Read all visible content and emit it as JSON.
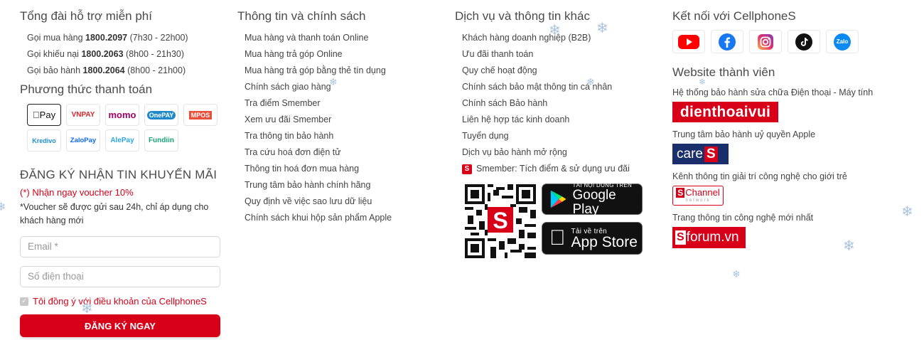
{
  "support": {
    "title": "Tổng đài hỗ trợ miễn phí",
    "lines": [
      {
        "prefix": "Gọi mua hàng",
        "number": "1800.2097",
        "hours": "(7h30 - 22h00)"
      },
      {
        "prefix": "Gọi khiếu nại",
        "number": "1800.2063",
        "hours": "(8h00 - 21h30)"
      },
      {
        "prefix": "Gọi bảo hành",
        "number": "1800.2064",
        "hours": "(8h00 - 21h00)"
      }
    ]
  },
  "payment": {
    "title": "Phương thức thanh toán",
    "methods": [
      "Pay",
      "VNPAY",
      "momo",
      "OnePAY",
      "MPOS",
      "Kredivo",
      "ZaloPay",
      "AlePay",
      "Fundiin"
    ]
  },
  "newsletter": {
    "title": "ĐĂNG KÝ NHẬN TIN KHUYẾN MÃI",
    "voucher": "(*) Nhận ngay voucher 10%",
    "note": "*Voucher sẽ được gửi sau 24h, chỉ áp dụng cho khách hàng mới",
    "email_placeholder": "Email *",
    "phone_placeholder": "Số điện thoại",
    "agree_text": "Tôi đồng ý với điều khoản của CellphoneS",
    "submit_label": "ĐĂNG KÝ NGAY"
  },
  "policy": {
    "title": "Thông tin và chính sách",
    "links": [
      "Mua hàng và thanh toán Online",
      "Mua hàng trả góp Online",
      "Mua hàng trả góp bằng thẻ tín dụng",
      "Chính sách giao hàng",
      "Tra điểm Smember",
      "Xem ưu đãi Smember",
      "Tra thông tin bảo hành",
      "Tra cứu hoá đơn điện tử",
      "Thông tin hoá đơn mua hàng",
      "Trung tâm bảo hành chính hãng",
      "Quy định về việc sao lưu dữ liệu",
      "Chính sách khui hộp sản phẩm Apple"
    ]
  },
  "services": {
    "title": "Dịch vụ và thông tin khác",
    "links": [
      "Khách hàng doanh nghiệp (B2B)",
      "Ưu đãi thanh toán",
      "Quy chế hoạt động",
      "Chính sách bảo mật thông tin cá nhân",
      "Chính sách Bảo hành",
      "Liên hệ hợp tác kinh doanh",
      "Tuyển dụng",
      "Dịch vụ bảo hành mở rộng"
    ],
    "smember_link": "Smember: Tích điểm & sử dụng ưu đãi",
    "google_play_small": "TẢI NỘI DUNG TRÊN",
    "google_play_big": "Google Play",
    "app_store_small": "Tải về trên",
    "app_store_big": "App Store"
  },
  "connect": {
    "title": "Kết nối với CellphoneS",
    "social": [
      "youtube-icon",
      "facebook-icon",
      "instagram-icon",
      "tiktok-icon",
      "zalo-icon"
    ],
    "zalo_label": "Zalo"
  },
  "members": {
    "title": "Website thành viên",
    "sites": [
      {
        "label": "Hệ thống bảo hành sửa chữa Điện thoại - Máy tính",
        "logo": "dienthoaivui"
      },
      {
        "label": "Trung tâm bảo hành uỷ quyền Apple",
        "logo_text": "care",
        "logo_s": "S"
      },
      {
        "label": "Kênh thông tin giải trí công nghệ cho giới trẻ",
        "logo": "Channel",
        "logo_sub": "network"
      },
      {
        "label": "Trang thông tin công nghệ mới nhất",
        "logo": "forum.vn"
      }
    ]
  },
  "colors": {
    "brand_red": "#d70018",
    "care_blue": "#1a2e6b"
  }
}
